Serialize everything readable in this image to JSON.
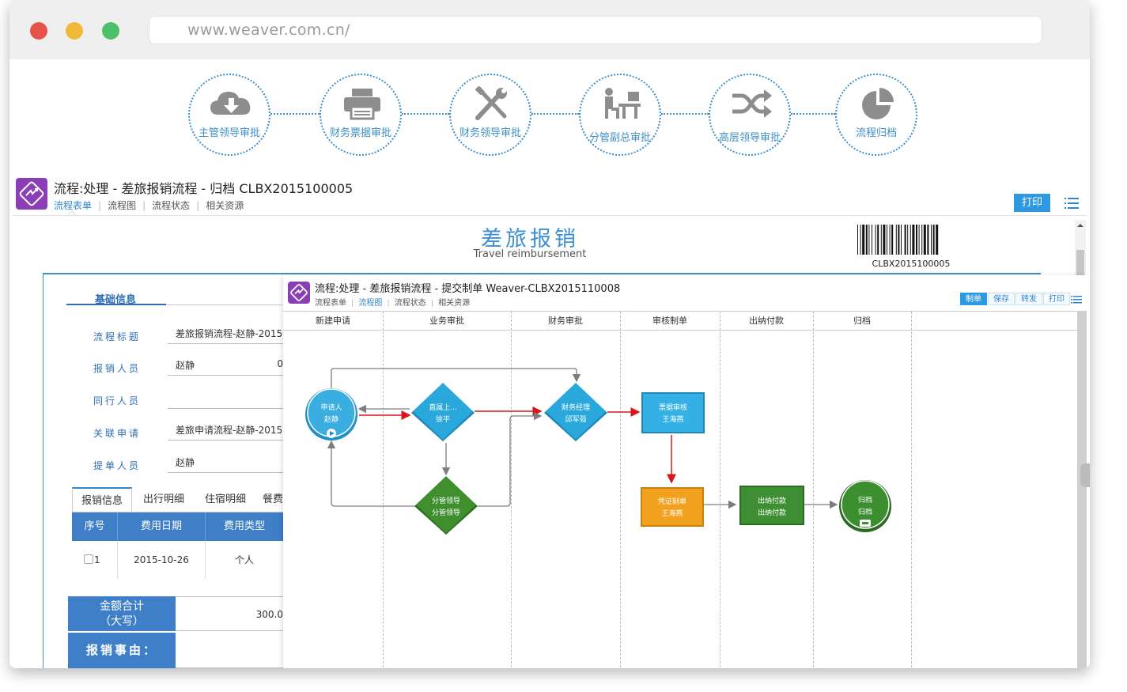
{
  "browser": {
    "url": "www.weaver.com.cn/",
    "dots": [
      "#e5534b",
      "#f0b93a",
      "#4fc06a"
    ]
  },
  "steps": [
    {
      "label": "主管领导审批",
      "icon": "cloud-download-icon"
    },
    {
      "label": "财务票据审批",
      "icon": "printer-icon"
    },
    {
      "label": "财务领导审批",
      "icon": "tools-icon"
    },
    {
      "label": "分管副总审批",
      "icon": "office-desk-icon"
    },
    {
      "label": "高层领导审批",
      "icon": "shuffle-icon"
    },
    {
      "label": "流程归档",
      "icon": "pie-chart-icon"
    }
  ],
  "main": {
    "title": "流程:处理 - 差旅报销流程 - 归档 CLBX2015100005",
    "tabs": [
      "流程表单",
      "流程图",
      "流程状态",
      "相关资源"
    ],
    "active_tab": 0,
    "print_label": "打印"
  },
  "form": {
    "title_cn": "差旅报销",
    "title_en": "Travel reimbursement",
    "barcode_text": "CLBX2015100005",
    "section_title": "基础信息",
    "fields": [
      {
        "label": "流程标题",
        "value": "差旅报销流程-赵静-2015"
      },
      {
        "label": "报销人员",
        "value": "赵静",
        "extra": "0"
      },
      {
        "label": "同行人员",
        "value": ""
      },
      {
        "label": "关联申请",
        "value": "差旅申请流程-赵静-2015"
      },
      {
        "label": "提单人员",
        "value": "赵静"
      }
    ],
    "subtabs": [
      "报销信息",
      "出行明细",
      "住宿明细",
      "餐费"
    ],
    "table_headers": [
      "序号",
      "费用日期",
      "费用类型"
    ],
    "table_rows": [
      {
        "index": "1",
        "date": "2015-10-26",
        "type": "个人"
      }
    ],
    "total_label_1": "金额合计",
    "total_label_2": "（大写）",
    "total_value": "300.0",
    "reason_label": "报销事由："
  },
  "panel": {
    "title": "流程:处理 - 差旅报销流程 - 提交制单 Weaver-CLBX2015110008",
    "tabs": [
      "流程表单",
      "流程图",
      "流程状态",
      "相关资源"
    ],
    "active_tab": 1,
    "buttons": [
      "制单",
      "保存",
      "转发",
      "打印"
    ],
    "lanes": [
      "新建申请",
      "业务审批",
      "财务审批",
      "审核制单",
      "出纳付款",
      "归档"
    ],
    "nodes": {
      "start": [
        "申请人",
        "赵静"
      ],
      "biz": [
        "直属上...",
        "徐平"
      ],
      "fin": [
        "财务经理",
        "邱军强"
      ],
      "mgr": [
        "分管领导",
        "分管领导"
      ],
      "review": [
        "票据审核",
        "王海燕"
      ],
      "voucher": [
        "凭证制单",
        "王海燕"
      ],
      "cashier": [
        "出纳付款",
        "出纳付款"
      ],
      "end": [
        "归档",
        "归档"
      ]
    },
    "colors": {
      "start": "#3aaee0",
      "diamond_blue": "#2aa8dc",
      "diamond_green": "#3f8f2f",
      "rect_blue": "#35b0e6",
      "rect_orange": "#f2a11f",
      "rect_green": "#3e8e33",
      "end_green": "#3c8f2e",
      "arrow_red": "#d9151b",
      "arrow_gray": "#7d7d7d"
    }
  }
}
